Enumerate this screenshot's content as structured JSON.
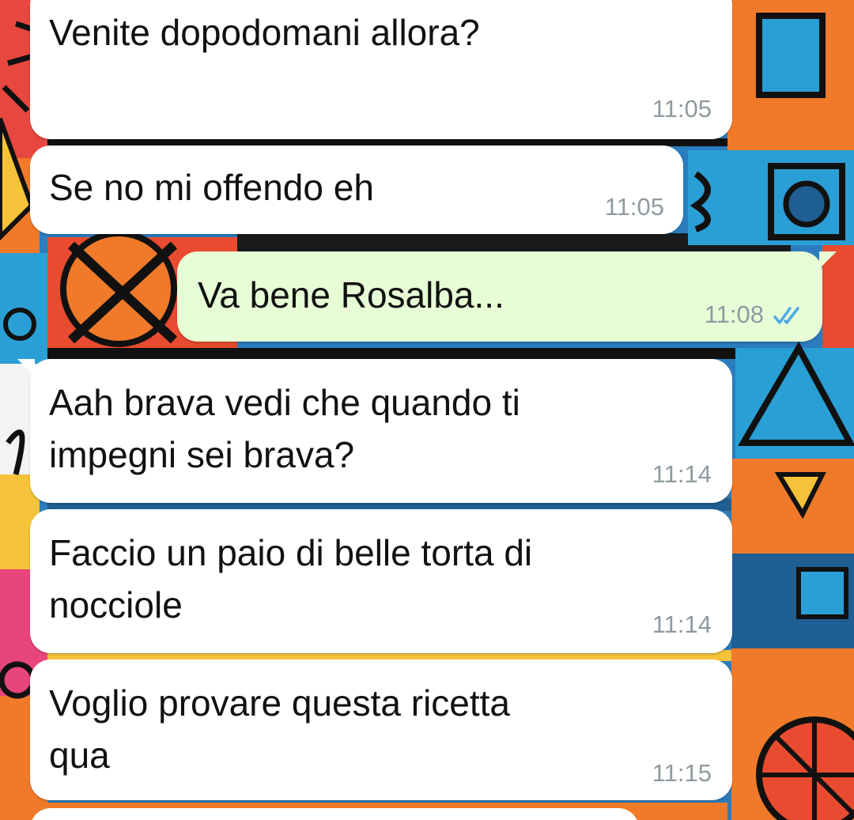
{
  "chat": {
    "messages": [
      {
        "direction": "incoming",
        "text": "Venite dopodomani allora?",
        "time": "11:05"
      },
      {
        "direction": "incoming",
        "text": "Se no mi offendo eh",
        "time": "11:05"
      },
      {
        "direction": "outgoing",
        "text": "Va bene Rosalba...",
        "time": "11:08",
        "status_icon": "double-check-read-icon"
      },
      {
        "direction": "incoming",
        "text": "Aah brava vedi che quando ti\nimpegni sei brava?",
        "time": "11:14"
      },
      {
        "direction": "incoming",
        "text": "Faccio un paio di belle torta di\nnocciole",
        "time": "11:14"
      },
      {
        "direction": "incoming",
        "text": "Voglio provare questa ricetta\nqua",
        "time": "11:15"
      }
    ]
  },
  "colors": {
    "incoming_bubble": "#ffffff",
    "outgoing_bubble": "#e7fdd6",
    "timestamp": "#8f9a9f",
    "read_ticks": "#4fa9e6"
  }
}
